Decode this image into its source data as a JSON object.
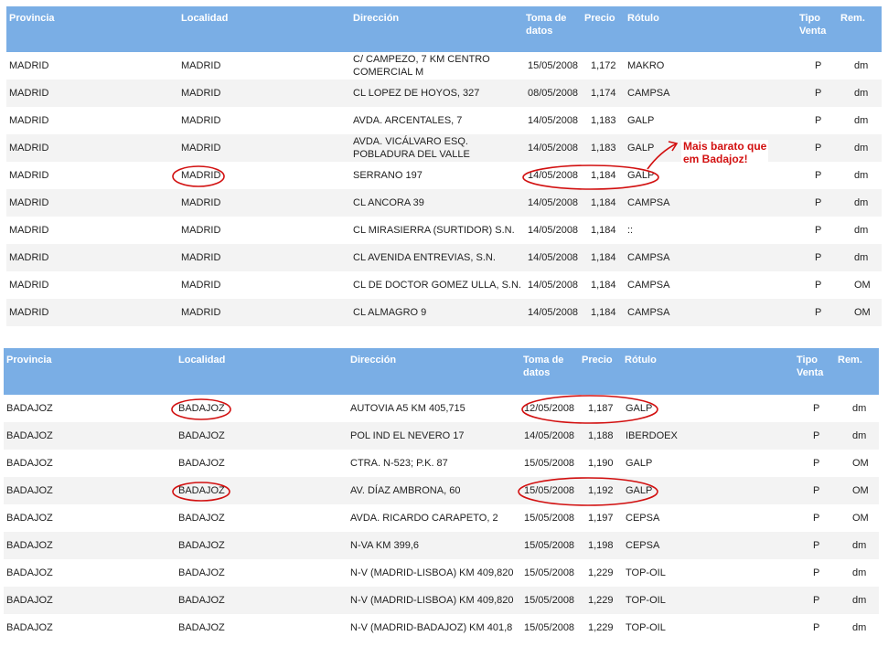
{
  "headers": {
    "provincia": "Provincia",
    "localidad": "Localidad",
    "direccion": "Dirección",
    "toma_1": "Toma de",
    "toma_2": "datos",
    "precio": "Precio",
    "rotulo": "Rótulo",
    "tipo_1": "Tipo",
    "tipo_2": "Venta",
    "rem": "Rem."
  },
  "annotation": {
    "line1": "Mais barato que",
    "line2": "em Badajoz!",
    "color": "#d21010"
  },
  "madrid_rows": [
    {
      "provincia": "MADRID",
      "localidad": "MADRID",
      "dir1": "C/ CAMPEZO, 7 KM CENTRO",
      "dir2": "COMERCIAL M",
      "toma": "15/05/2008",
      "precio": "1,172",
      "rotulo": "MAKRO",
      "tipo": "P",
      "rem": "dm"
    },
    {
      "provincia": "MADRID",
      "localidad": "MADRID",
      "dir1": "CL LOPEZ DE HOYOS, 327",
      "dir2": "",
      "toma": "08/05/2008",
      "precio": "1,174",
      "rotulo": "CAMPSA",
      "tipo": "P",
      "rem": "dm"
    },
    {
      "provincia": "MADRID",
      "localidad": "MADRID",
      "dir1": "AVDA. ARCENTALES, 7",
      "dir2": "",
      "toma": "14/05/2008",
      "precio": "1,183",
      "rotulo": "GALP",
      "tipo": "P",
      "rem": "dm"
    },
    {
      "provincia": "MADRID",
      "localidad": "MADRID",
      "dir1": "AVDA. VICÁLVARO ESQ.",
      "dir2": "POBLADURA DEL VALLE",
      "toma": "14/05/2008",
      "precio": "1,183",
      "rotulo": "GALP",
      "tipo": "P",
      "rem": "dm"
    },
    {
      "provincia": "MADRID",
      "localidad": "MADRID",
      "dir1": "SERRANO 197",
      "dir2": "",
      "toma": "14/05/2008",
      "precio": "1,184",
      "rotulo": "GALP",
      "tipo": "P",
      "rem": "dm"
    },
    {
      "provincia": "MADRID",
      "localidad": "MADRID",
      "dir1": "CL ANCORA 39",
      "dir2": "",
      "toma": "14/05/2008",
      "precio": "1,184",
      "rotulo": "CAMPSA",
      "tipo": "P",
      "rem": "dm"
    },
    {
      "provincia": "MADRID",
      "localidad": "MADRID",
      "dir1": "CL MIRASIERRA (SURTIDOR) S.N.",
      "dir2": "",
      "toma": "14/05/2008",
      "precio": "1,184",
      "rotulo": "::",
      "tipo": "P",
      "rem": "dm"
    },
    {
      "provincia": "MADRID",
      "localidad": "MADRID",
      "dir1": "CL AVENIDA ENTREVIAS, S.N.",
      "dir2": "",
      "toma": "14/05/2008",
      "precio": "1,184",
      "rotulo": "CAMPSA",
      "tipo": "P",
      "rem": "dm"
    },
    {
      "provincia": "MADRID",
      "localidad": "MADRID",
      "dir1": "CL DE DOCTOR GOMEZ ULLA, S.N.",
      "dir2": "",
      "toma": "14/05/2008",
      "precio": "1,184",
      "rotulo": "CAMPSA",
      "tipo": "P",
      "rem": "OM"
    },
    {
      "provincia": "MADRID",
      "localidad": "MADRID",
      "dir1": "CL ALMAGRO 9",
      "dir2": "",
      "toma": "14/05/2008",
      "precio": "1,184",
      "rotulo": "CAMPSA",
      "tipo": "P",
      "rem": "OM"
    }
  ],
  "badajoz_rows": [
    {
      "provincia": "BADAJOZ",
      "localidad": "BADAJOZ",
      "dir1": "AUTOVIA A5 KM 405,715",
      "dir2": "",
      "toma": "12/05/2008",
      "precio": "1,187",
      "rotulo": "GALP",
      "tipo": "P",
      "rem": "dm"
    },
    {
      "provincia": "BADAJOZ",
      "localidad": "BADAJOZ",
      "dir1": "POL IND EL NEVERO 17",
      "dir2": "",
      "toma": "14/05/2008",
      "precio": "1,188",
      "rotulo": "IBERDOEX",
      "tipo": "P",
      "rem": "dm"
    },
    {
      "provincia": "BADAJOZ",
      "localidad": "BADAJOZ",
      "dir1": "CTRA. N-523; P.K. 87",
      "dir2": "",
      "toma": "15/05/2008",
      "precio": "1,190",
      "rotulo": "GALP",
      "tipo": "P",
      "rem": "OM"
    },
    {
      "provincia": "BADAJOZ",
      "localidad": "BADAJOZ",
      "dir1": "AV. DÍAZ AMBRONA, 60",
      "dir2": "",
      "toma": "15/05/2008",
      "precio": "1,192",
      "rotulo": "GALP",
      "tipo": "P",
      "rem": "OM"
    },
    {
      "provincia": "BADAJOZ",
      "localidad": "BADAJOZ",
      "dir1": "AVDA. RICARDO CARAPETO, 2",
      "dir2": "",
      "toma": "15/05/2008",
      "precio": "1,197",
      "rotulo": "CEPSA",
      "tipo": "P",
      "rem": "OM"
    },
    {
      "provincia": "BADAJOZ",
      "localidad": "BADAJOZ",
      "dir1": "N-VA KM 399,6",
      "dir2": "",
      "toma": "15/05/2008",
      "precio": "1,198",
      "rotulo": "CEPSA",
      "tipo": "P",
      "rem": "dm"
    },
    {
      "provincia": "BADAJOZ",
      "localidad": "BADAJOZ",
      "dir1": "N-V (MADRID-LISBOA) KM 409,820",
      "dir2": "",
      "toma": "15/05/2008",
      "precio": "1,229",
      "rotulo": "TOP-OIL",
      "tipo": "P",
      "rem": "dm"
    },
    {
      "provincia": "BADAJOZ",
      "localidad": "BADAJOZ",
      "dir1": "N-V (MADRID-LISBOA) KM 409,820",
      "dir2": "",
      "toma": "15/05/2008",
      "precio": "1,229",
      "rotulo": "TOP-OIL",
      "tipo": "P",
      "rem": "dm"
    },
    {
      "provincia": "BADAJOZ",
      "localidad": "BADAJOZ",
      "dir1": "N-V (MADRID-BADAJOZ) KM 401,8",
      "dir2": "",
      "toma": "15/05/2008",
      "precio": "1,229",
      "rotulo": "TOP-OIL",
      "tipo": "P",
      "rem": "dm"
    }
  ]
}
